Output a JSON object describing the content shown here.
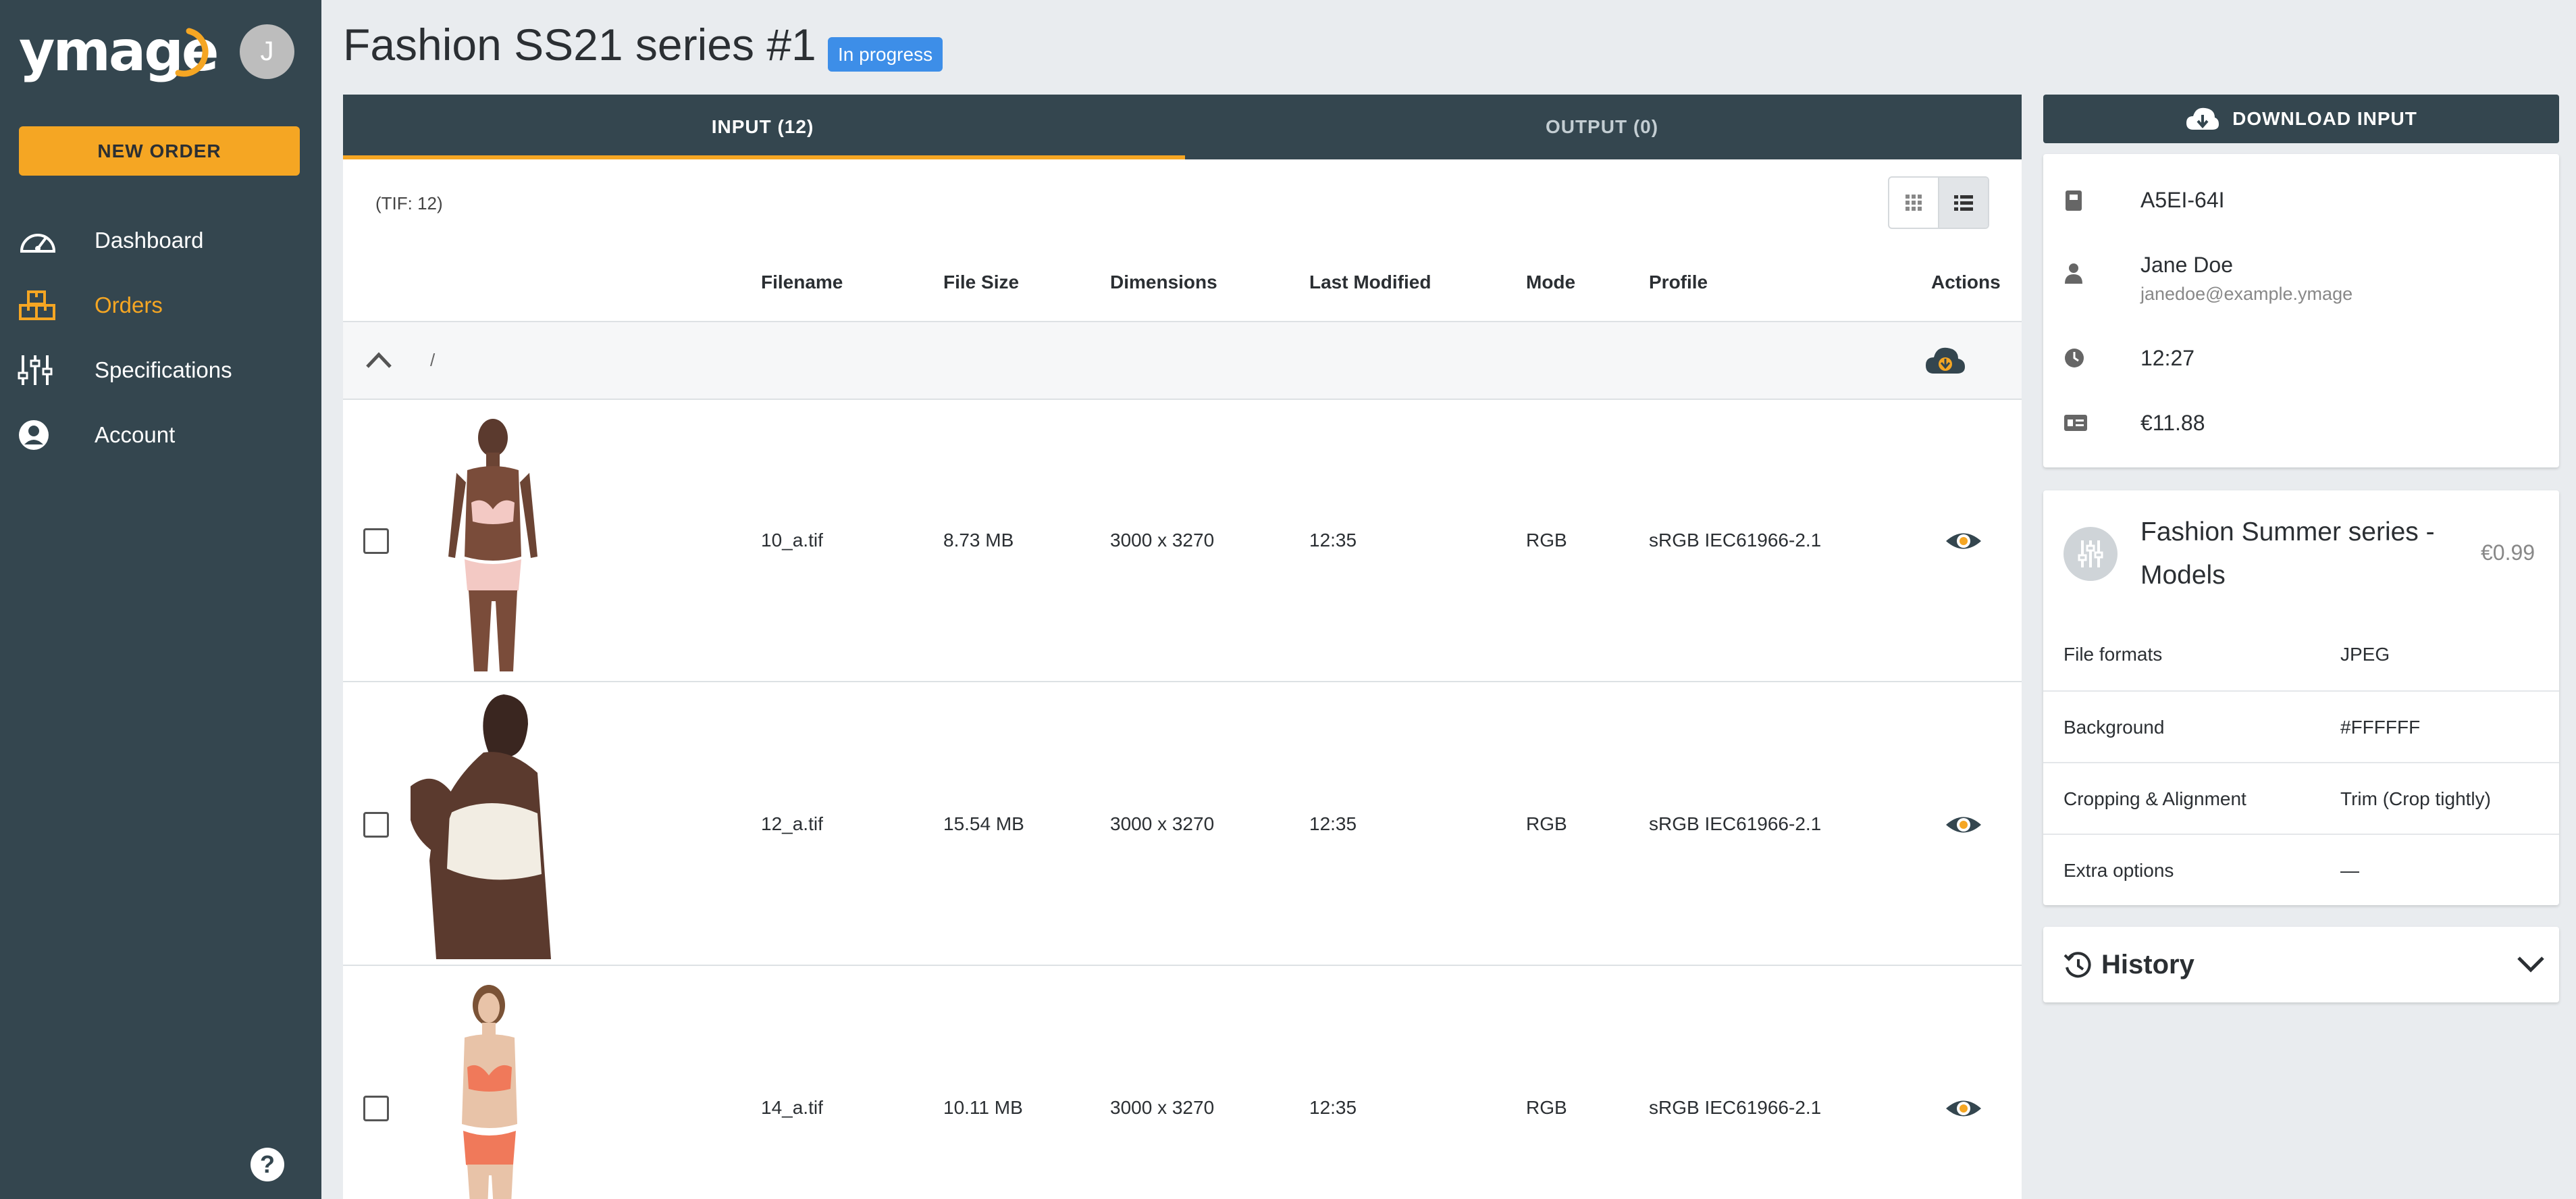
{
  "app": {
    "logo_text": "ymage",
    "avatar_initial": "J",
    "new_order_label": "NEW ORDER",
    "help_glyph": "?"
  },
  "sidebar": {
    "items": [
      {
        "label": "Dashboard",
        "icon": "speedometer-icon",
        "active": false
      },
      {
        "label": "Orders",
        "icon": "boxes-icon",
        "active": true
      },
      {
        "label": "Specifications",
        "icon": "sliders-icon",
        "active": false
      },
      {
        "label": "Account",
        "icon": "account-circle-icon",
        "active": false
      }
    ]
  },
  "header": {
    "title": "Fashion SS21 series #1",
    "status": "In progress"
  },
  "tabs": [
    {
      "label": "INPUT (12)",
      "active": true
    },
    {
      "label": "OUTPUT (0)",
      "active": false
    }
  ],
  "file_types": "(TIF: 12)",
  "table": {
    "columns": [
      "Filename",
      "File Size",
      "Dimensions",
      "Last Modified",
      "Mode",
      "Profile",
      "Actions"
    ],
    "folder_path": "/",
    "rows": [
      {
        "filename": "10_a.tif",
        "size": "8.73 MB",
        "dimensions": "3000 x 3270",
        "modified": "12:35",
        "mode": "RGB",
        "profile": "sRGB IEC61966-2.1"
      },
      {
        "filename": "12_a.tif",
        "size": "15.54 MB",
        "dimensions": "3000 x 3270",
        "modified": "12:35",
        "mode": "RGB",
        "profile": "sRGB IEC61966-2.1"
      },
      {
        "filename": "14_a.tif",
        "size": "10.11 MB",
        "dimensions": "3000 x 3270",
        "modified": "12:35",
        "mode": "RGB",
        "profile": "sRGB IEC61966-2.1"
      }
    ]
  },
  "order_info": {
    "download_label": "DOWNLOAD INPUT",
    "order_id": "A5EI-64I",
    "customer_name": "Jane Doe",
    "customer_email": "janedoe@example.ymage",
    "time": "12:27",
    "price": "€11.88"
  },
  "specification": {
    "title": "Fashion Summer series - Models",
    "price": "€0.99",
    "rows": [
      {
        "key": "File formats",
        "value": "JPEG"
      },
      {
        "key": "Background",
        "value": "#FFFFFF"
      },
      {
        "key": "Cropping & Alignment",
        "value": "Trim (Crop tightly)"
      },
      {
        "key": "Extra options",
        "value": "—"
      }
    ]
  },
  "history": {
    "title": "History"
  },
  "colors": {
    "sidebar_bg": "#34464f",
    "accent": "#f5a623",
    "badge": "#3d8ee8",
    "page_bg": "#e9ecef"
  }
}
